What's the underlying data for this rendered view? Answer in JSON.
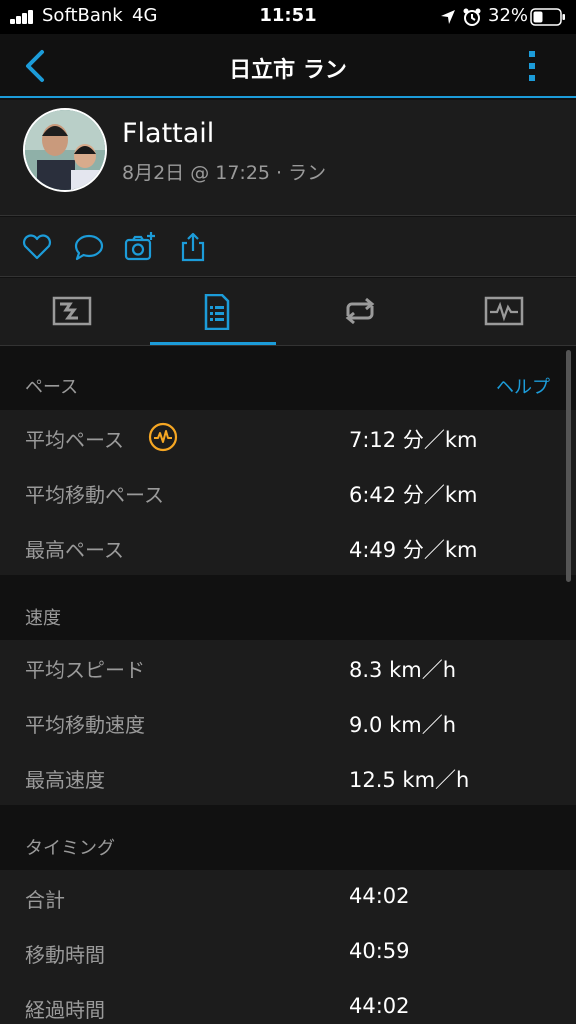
{
  "status": {
    "carrier": "SoftBank",
    "network": "4G",
    "time": "11:51",
    "battery": "32%"
  },
  "nav": {
    "title": "日立市 ラン"
  },
  "profile": {
    "name": "Flattail",
    "meta": "8月2日 @ 17:25 · ラン"
  },
  "colors": {
    "accent": "#1c9cd9",
    "badge": "#f5a623"
  },
  "sections": {
    "pace": {
      "title": "ペース",
      "help": "ヘルプ",
      "rows": [
        {
          "label": "平均ペース",
          "value": "7:12 分／km"
        },
        {
          "label": "平均移動ペース",
          "value": "6:42 分／km"
        },
        {
          "label": "最高ペース",
          "value": "4:49 分／km"
        }
      ]
    },
    "speed": {
      "title": "速度",
      "rows": [
        {
          "label": "平均スピード",
          "value": "8.3 km／h"
        },
        {
          "label": "平均移動速度",
          "value": "9.0 km／h"
        },
        {
          "label": "最高速度",
          "value": "12.5 km／h"
        }
      ]
    },
    "timing": {
      "title": "タイミング",
      "rows": [
        {
          "label": "合計",
          "value": "44:02"
        },
        {
          "label": "移動時間",
          "value": "40:59"
        },
        {
          "label": "経過時間",
          "value": "44:02"
        }
      ]
    }
  }
}
